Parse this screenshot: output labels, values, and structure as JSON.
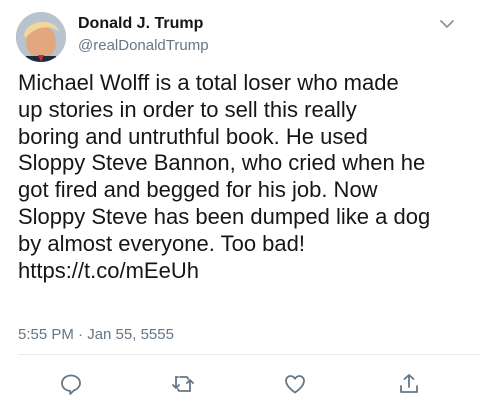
{
  "author": {
    "display_name": "Donald J. Trump",
    "handle": "@realDonaldTrump",
    "avatar_icon": "profile-avatar"
  },
  "tweet": {
    "text": "Michael Wolff is a total loser who made\nup stories in order to sell this really\nboring and untruthful book. He used\nSloppy Steve Bannon, who cried when he\ngot fired and begged for his job. Now\nSloppy Steve has been dumped like a dog\nby almost everyone. Too bad!\nhttps://t.co/mEeUh",
    "timestamp": "5:55 PM · Jan 55, 5555"
  },
  "actions": [
    {
      "name": "reply",
      "icon": "speech-bubble-icon"
    },
    {
      "name": "retweet",
      "icon": "retweet-icon"
    },
    {
      "name": "like",
      "icon": "heart-icon"
    },
    {
      "name": "share",
      "icon": "share-icon"
    }
  ],
  "colors": {
    "text": "#14171a",
    "muted": "#657786",
    "icon": "#657786",
    "divider": "#e6ecf0"
  }
}
